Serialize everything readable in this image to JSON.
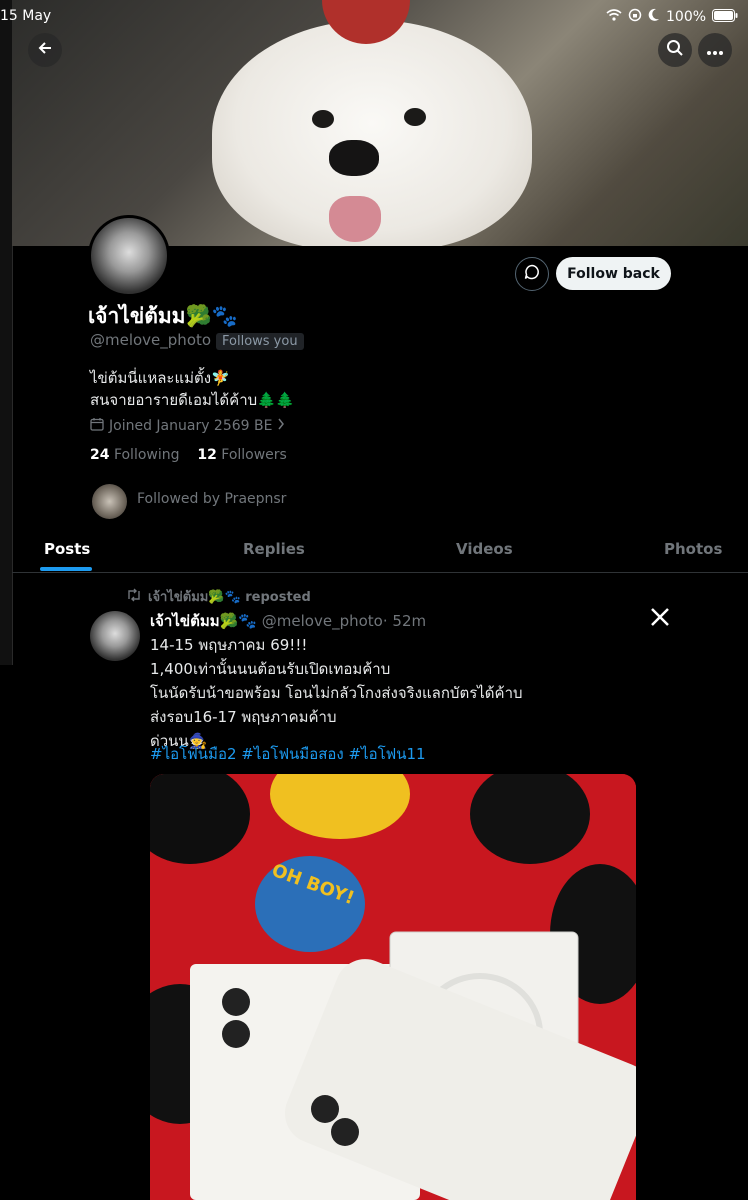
{
  "status_bar": {
    "date": "15 May",
    "battery": "100%"
  },
  "profile": {
    "name": "เจ้าไข่ต้มม🥦🐾",
    "handle": "@melove_photo",
    "follows_you": "Follows you",
    "bio_line1": "ไข่ต้มนี่แหละแม่ตั้ง🧚",
    "bio_line2": "สนจายอารายดีเอมได้ค้าบ🌲🌲",
    "joined": "Joined January 2569 BE",
    "following_count": "24",
    "following_label": "Following",
    "followers_count": "12",
    "followers_label": "Followers",
    "followed_by": "Followed by Praepnsr",
    "follow_back_label": "Follow back"
  },
  "tabs": [
    "Posts",
    "Replies",
    "Videos",
    "Photos"
  ],
  "post": {
    "repost_label": "เจ้าไข่ต้มม🥦🐾 reposted",
    "author": "เจ้าไข่ต้มม🥦🐾",
    "handle": "@melove_photo",
    "time": "· 52m",
    "line1": "14-15 พฤษภาคม 69!!!",
    "line2": "1,400เท่านั้นนนต้อนรับเปิดเทอมค้าบ",
    "line3": "โนนัดรับน้าขอพร้อม โอนไม่กลัวโกงส่งจริงแลกบัตรได้ค้าบ",
    "line4": "ส่งรอบ16-17 พฤษภาคมค้าบ",
    "line5": "ด่วนน🧙",
    "hashtags": "#ไอโฟนมือ2 #ไอโฟนมือสอง #ไอโฟน11",
    "media_text": "OH BOY!"
  }
}
